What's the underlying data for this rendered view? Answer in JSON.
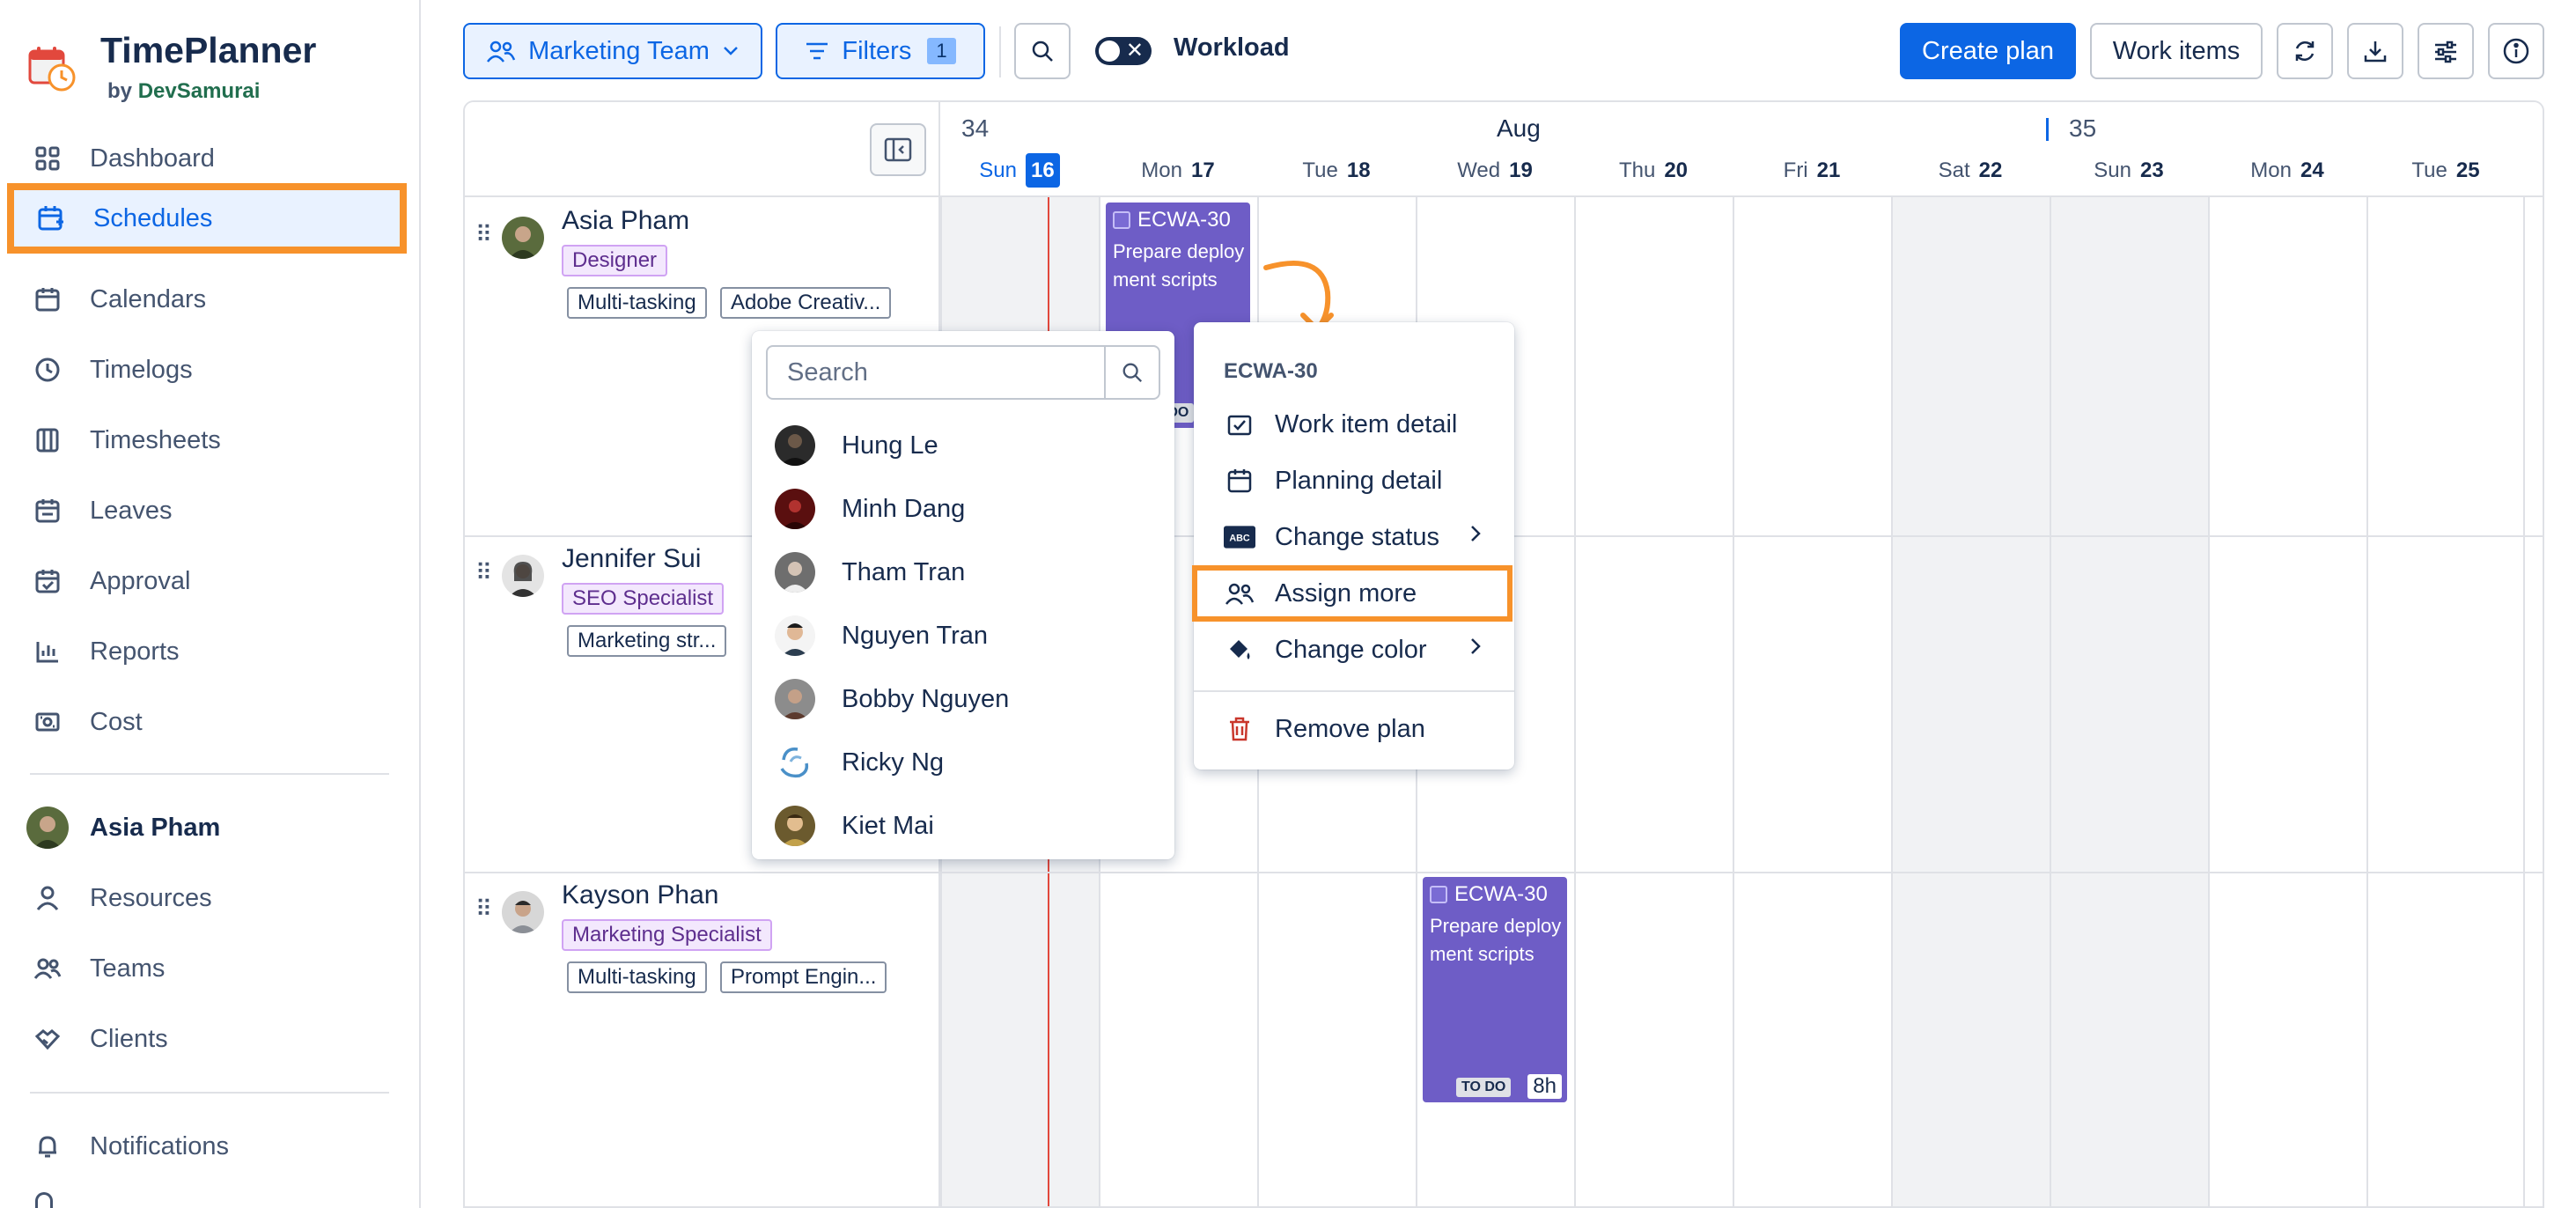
{
  "brand": {
    "title": "TimePlanner",
    "by": "by",
    "company": "DevSamurai"
  },
  "sidebar": {
    "items": [
      {
        "label": "Dashboard",
        "icon": "dashboard-icon"
      },
      {
        "label": "Schedules",
        "icon": "schedule-icon",
        "active": true
      },
      {
        "label": "Calendars",
        "icon": "calendar-icon"
      },
      {
        "label": "Timelogs",
        "icon": "clock-icon"
      },
      {
        "label": "Timesheets",
        "icon": "timesheet-icon"
      },
      {
        "label": "Leaves",
        "icon": "leave-icon"
      },
      {
        "label": "Approval",
        "icon": "approval-icon"
      },
      {
        "label": "Reports",
        "icon": "chart-icon"
      },
      {
        "label": "Cost",
        "icon": "cost-icon"
      }
    ],
    "profile": {
      "name": "Asia Pham"
    },
    "items2": [
      {
        "label": "Resources",
        "icon": "person-icon"
      },
      {
        "label": "Teams",
        "icon": "people-icon"
      },
      {
        "label": "Clients",
        "icon": "handshake-icon"
      }
    ],
    "items3": [
      {
        "label": "Notifications",
        "icon": "bell-icon"
      }
    ]
  },
  "toolbar": {
    "team_label": "Marketing Team",
    "filters_label": "Filters",
    "filters_count": "1",
    "workload_label": "Workload",
    "create_plan_label": "Create plan",
    "work_items_label": "Work items"
  },
  "calendar": {
    "week_start": "34",
    "week_next": "35",
    "month": "Aug",
    "days": [
      {
        "dow": "Sun",
        "num": "16",
        "today": true
      },
      {
        "dow": "Mon",
        "num": "17"
      },
      {
        "dow": "Tue",
        "num": "18"
      },
      {
        "dow": "Wed",
        "num": "19"
      },
      {
        "dow": "Thu",
        "num": "20"
      },
      {
        "dow": "Fri",
        "num": "21"
      },
      {
        "dow": "Sat",
        "num": "22"
      },
      {
        "dow": "Sun",
        "num": "23"
      },
      {
        "dow": "Mon",
        "num": "24"
      },
      {
        "dow": "Tue",
        "num": "25"
      }
    ]
  },
  "resources": [
    {
      "name": "Asia Pham",
      "role": "Designer",
      "skills": [
        "Multi-tasking",
        "Adobe Creativ..."
      ]
    },
    {
      "name": "Jennifer Sui",
      "role": "SEO Specialist",
      "skills": [
        "Marketing str..."
      ]
    },
    {
      "name": "Kayson Phan",
      "role": "Marketing Specialist",
      "skills": [
        "Multi-tasking",
        "Prompt Engin..."
      ]
    }
  ],
  "plans": [
    {
      "key": "ECWA-30",
      "title": "Prepare deployment scripts",
      "status": "TO DO",
      "hours": "8h"
    },
    {
      "key": "ECWA-30",
      "title": "Prepare deployment scripts",
      "status": "TO DO",
      "hours": "8h"
    }
  ],
  "assign_popup": {
    "search_placeholder": "Search",
    "people": [
      "Hung Le",
      "Minh Dang",
      "Tham Tran",
      "Nguyen Tran",
      "Bobby Nguyen",
      "Ricky Ng",
      "Kiet Mai"
    ]
  },
  "context_menu": {
    "header": "ECWA-30",
    "items": [
      {
        "label": "Work item detail",
        "icon": "checkbox-icon"
      },
      {
        "label": "Planning detail",
        "icon": "calendar-icon"
      },
      {
        "label": "Change status",
        "icon": "abc-icon",
        "submenu": true
      },
      {
        "label": "Assign more",
        "icon": "people-icon",
        "highlight": true
      },
      {
        "label": "Change color",
        "icon": "paint-bucket-icon",
        "submenu": true
      },
      {
        "label": "Remove plan",
        "icon": "trash-icon"
      }
    ]
  },
  "colors": {
    "accent": "#0c66e4",
    "highlight": "#f7922b",
    "plan": "#6e5dc6",
    "tag": "#f3e8fd"
  }
}
